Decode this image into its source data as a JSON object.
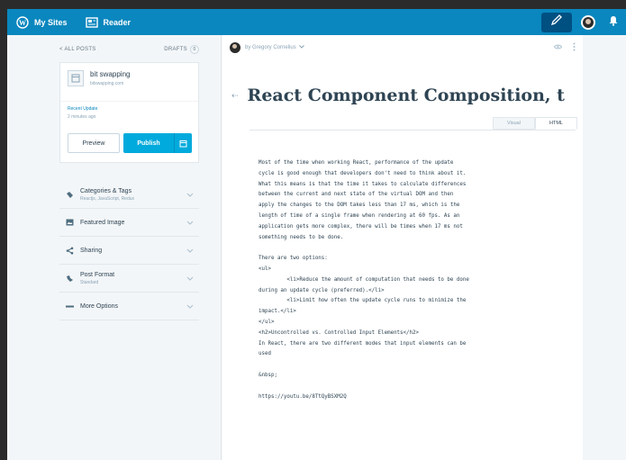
{
  "masterbar": {
    "my_sites": "My Sites",
    "reader": "Reader",
    "colors": {
      "bar": "#0a87be",
      "write_button": "#005082"
    }
  },
  "sidebar": {
    "all_posts": "< ALL POSTS",
    "drafts_label": "DRAFTS",
    "drafts_count": "0",
    "site": {
      "name": "bit swapping",
      "url": "bitswapping.com"
    },
    "status": {
      "title": "Recent Update",
      "sub": "2 minutes ago"
    },
    "preview_label": "Preview",
    "publish_label": "Publish",
    "sections": [
      {
        "label": "Categories & Tags",
        "sub": "Reactjs, JavaScript, Redux",
        "icon": "folder-icon"
      },
      {
        "label": "Featured Image",
        "sub": "",
        "icon": "image-icon"
      },
      {
        "label": "Sharing",
        "sub": "",
        "icon": "share-icon"
      },
      {
        "label": "Post Format",
        "sub": "Standard",
        "icon": "format-icon"
      },
      {
        "label": "More Options",
        "sub": "",
        "icon": "more-icon"
      }
    ],
    "colors": {
      "publish": "#00aadc",
      "link": "#0a87be"
    }
  },
  "editor": {
    "author": "by Gregory Cornelius",
    "back_glyph": "⇠",
    "title": "React Component Composition, t",
    "modes": [
      "Visual",
      "HTML"
    ],
    "active_mode": "HTML",
    "paragraphs": [
      "Most of the time when working React, performance of the update\ncycle is good enough that developers don't need to think about it.\nWhat this means is that the time it takes to calculate differences\nbetween the current and next state of the virtual DOM and then\napply the changes to the DOM takes less than 17 ms, which is the\nlength of time of a single frame when rendering at 60 fps. As an\napplication gets more complex, there will be times when 17 ms not\nsomething needs to be done.",
      "There are two options:\n<ul>\n         <li>Reduce the amount of computation that needs to be done\nduring an update cycle (preferred).</li>\n         <li>Limit how often the update cycle runs to minimize the\nimpact.</li>\n</ul>\n<h2>Uncontrolled vs. Controlled Input Elements</h2>\nIn React, there are two different modes that input elements can be\nused",
      "&nbsp;",
      "https://youtu.be/8TtQyBSXM2Q"
    ]
  }
}
